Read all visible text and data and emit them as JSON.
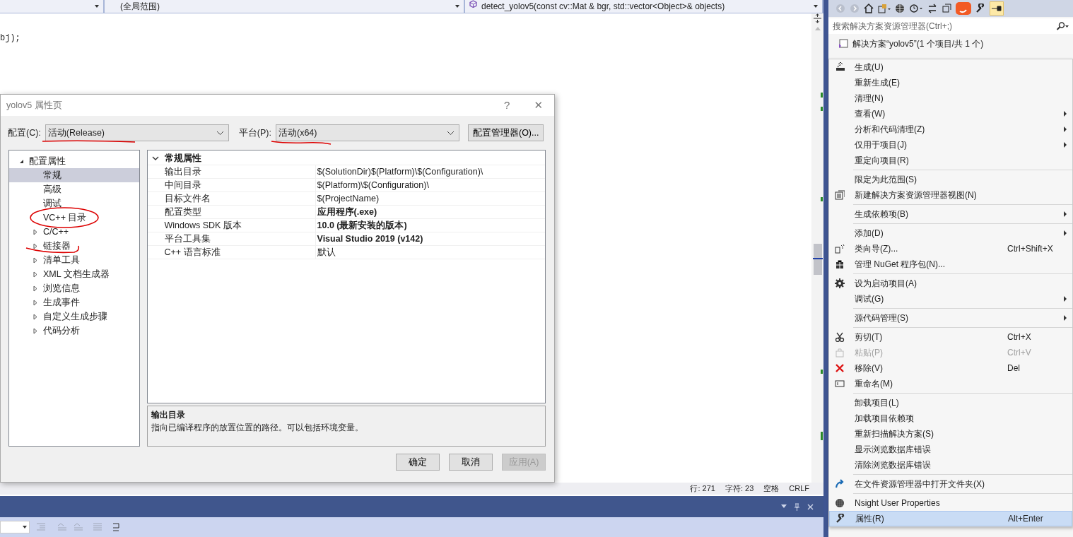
{
  "editor": {
    "nav": [
      {
        "text": "(全局范围)"
      },
      {
        "text": "detect_yolov5(const cv::Mat & bgr, std::vector<Object>& objects)"
      }
    ],
    "code_line": "bj);"
  },
  "status_bar": {
    "line": "行: 271",
    "column": "字符: 23",
    "indent": "空格",
    "eol": "CRLF"
  },
  "solution_explorer": {
    "search_placeholder": "搜索解决方案资源管理器(Ctrl+;)",
    "solution": "解决方案“yolov5”(1 个项目/共 1 个)"
  },
  "dialog": {
    "title": "yolov5 属性页",
    "help": "?",
    "close": "✕",
    "config_label": "配置(C):",
    "config_value": "活动(Release)",
    "platform_label": "平台(P):",
    "platform_value": "活动(x64)",
    "manager_button": "配置管理器(O)...",
    "tree": [
      {
        "label": "配置属性",
        "expanded": true,
        "children": [
          {
            "label": "常规",
            "selected": true
          },
          {
            "label": "高级",
            "selected": false
          },
          {
            "label": "调试",
            "selected": false
          },
          {
            "label": "VC++ 目录",
            "selected": false
          },
          {
            "label": "C/C++",
            "selected": false,
            "expanded": false
          },
          {
            "label": "链接器",
            "selected": false,
            "expanded": false
          },
          {
            "label": "清单工具",
            "selected": false,
            "expanded": false
          },
          {
            "label": "XML 文档生成器",
            "selected": false,
            "expanded": false
          },
          {
            "label": "浏览信息",
            "selected": false,
            "expanded": false
          },
          {
            "label": "生成事件",
            "selected": false,
            "expanded": false
          },
          {
            "label": "自定义生成步骤",
            "selected": false,
            "expanded": false
          },
          {
            "label": "代码分析",
            "selected": false,
            "expanded": false
          }
        ]
      }
    ],
    "grid": {
      "category": "常规属性",
      "expanded": true,
      "rows": [
        {
          "name": "输出目录",
          "value": "$(SolutionDir)$(Platform)\\$(Configuration)\\",
          "bold": false
        },
        {
          "name": "中间目录",
          "value": "$(Platform)\\$(Configuration)\\",
          "bold": false
        },
        {
          "name": "目标文件名",
          "value": "$(ProjectName)",
          "bold": false
        },
        {
          "name": "配置类型",
          "value": "应用程序(.exe)",
          "bold": true
        },
        {
          "name": "Windows SDK 版本",
          "value": "10.0 (最新安装的版本)",
          "bold": true
        },
        {
          "name": "平台工具集",
          "value": "Visual Studio 2019 (v142)",
          "bold": true
        },
        {
          "name": "C++ 语言标准",
          "value": "默认",
          "bold": false
        }
      ]
    },
    "description": {
      "title": "输出目录",
      "text": "指向已编译程序的放置位置的路径。可以包括环境变量。"
    },
    "buttons": [
      {
        "label": "确定",
        "disabled": false
      },
      {
        "label": "取消",
        "disabled": false
      },
      {
        "label": "应用(A)",
        "disabled": true
      }
    ]
  },
  "context_menu": [
    {
      "kind": "item",
      "label": "生成(U)"
    },
    {
      "kind": "item",
      "label": "重新生成(E)"
    },
    {
      "kind": "item",
      "label": "清理(N)"
    },
    {
      "kind": "item",
      "label": "查看(W)",
      "submenu": true
    },
    {
      "kind": "item",
      "label": "分析和代码清理(Z)",
      "submenu": true
    },
    {
      "kind": "item",
      "label": "仅用于项目(J)",
      "submenu": true
    },
    {
      "kind": "item",
      "label": "重定向项目(R)"
    },
    {
      "kind": "separator"
    },
    {
      "kind": "item",
      "label": "限定为此范围(S)"
    },
    {
      "kind": "item",
      "label": "新建解决方案资源管理器视图(N)"
    },
    {
      "kind": "separator"
    },
    {
      "kind": "item",
      "label": "生成依赖项(B)",
      "submenu": true
    },
    {
      "kind": "separator"
    },
    {
      "kind": "item",
      "label": "添加(D)",
      "submenu": true
    },
    {
      "kind": "item",
      "label": "类向导(Z)...",
      "shortcut": "Ctrl+Shift+X"
    },
    {
      "kind": "item",
      "label": "管理 NuGet 程序包(N)..."
    },
    {
      "kind": "separator"
    },
    {
      "kind": "item",
      "label": "设为启动项目(A)"
    },
    {
      "kind": "item",
      "label": "调试(G)",
      "submenu": true
    },
    {
      "kind": "separator"
    },
    {
      "kind": "item",
      "label": "源代码管理(S)",
      "submenu": true
    },
    {
      "kind": "separator"
    },
    {
      "kind": "item",
      "label": "剪切(T)",
      "shortcut": "Ctrl+X"
    },
    {
      "kind": "item",
      "label": "粘贴(P)",
      "shortcut": "Ctrl+V",
      "disabled": true
    },
    {
      "kind": "item",
      "label": "移除(V)",
      "shortcut": "Del"
    },
    {
      "kind": "item",
      "label": "重命名(M)"
    },
    {
      "kind": "separator"
    },
    {
      "kind": "item",
      "label": "卸载项目(L)"
    },
    {
      "kind": "item",
      "label": "加载项目依赖项"
    },
    {
      "kind": "item",
      "label": "重新扫描解决方案(S)"
    },
    {
      "kind": "item",
      "label": "显示浏览数据库错误"
    },
    {
      "kind": "item",
      "label": "清除浏览数据库错误"
    },
    {
      "kind": "separator"
    },
    {
      "kind": "item",
      "label": "在文件资源管理器中打开文件夹(X)"
    },
    {
      "kind": "separator"
    },
    {
      "kind": "item",
      "label": "Nsight User Properties"
    },
    {
      "kind": "item",
      "label": "属性(R)",
      "shortcut": "Alt+Enter",
      "selected": true
    }
  ]
}
